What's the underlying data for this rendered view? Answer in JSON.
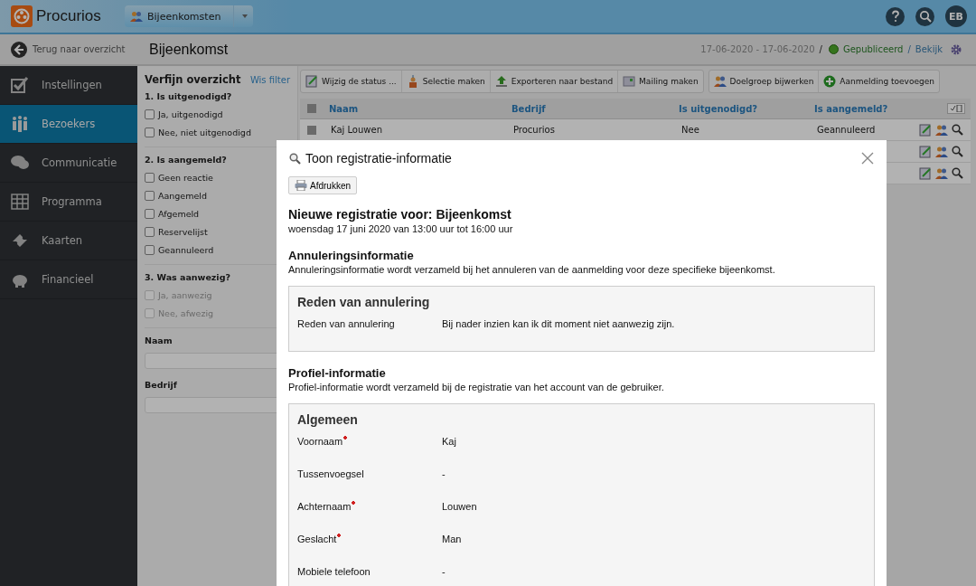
{
  "topbar": {
    "logo": "Procurios",
    "module": "Bijeenkomsten",
    "avatar": "EB"
  },
  "subheader": {
    "back": "Terug naar overzicht",
    "title": "Bijeenkomst",
    "dates": "17-06-2020 - 17-06-2020",
    "separator": "/",
    "status": "Gepubliceerd",
    "separator2": "/",
    "view": "Bekijk"
  },
  "sidebar": {
    "items": [
      {
        "label": "Instellingen",
        "kind": "check",
        "selected": false
      },
      {
        "label": "Bezoekers",
        "kind": "people",
        "selected": true
      },
      {
        "label": "Communicatie",
        "kind": "chat",
        "selected": false
      },
      {
        "label": "Programma",
        "kind": "grid",
        "selected": false
      },
      {
        "label": "Kaarten",
        "kind": "ticket",
        "selected": false
      },
      {
        "label": "Financieel",
        "kind": "piggy",
        "selected": false
      }
    ]
  },
  "filter": {
    "title": "Verfijn overzicht",
    "clear": "Wis filter",
    "groups": [
      {
        "title": "1. Is uitgenodigd?",
        "options": [
          {
            "label": "Ja, uitgenodigd",
            "checked": false,
            "disabled": false
          },
          {
            "label": "Nee, niet uitgenodigd",
            "checked": false,
            "disabled": false
          }
        ]
      },
      {
        "title": "2. Is aangemeld?",
        "options": [
          {
            "label": "Geen reactie",
            "checked": false,
            "disabled": false
          },
          {
            "label": "Aangemeld",
            "checked": false,
            "disabled": false
          },
          {
            "label": "Afgemeld",
            "checked": false,
            "disabled": false
          },
          {
            "label": "Reservelijst",
            "checked": false,
            "disabled": false
          },
          {
            "label": "Geannuleerd",
            "checked": false,
            "disabled": false
          }
        ]
      },
      {
        "title": "3. Was aanwezig?",
        "options": [
          {
            "label": "Ja, aanwezig",
            "checked": false,
            "disabled": true
          },
          {
            "label": "Nee, afwezig",
            "checked": false,
            "disabled": true
          }
        ]
      }
    ],
    "fields": [
      {
        "label": "Naam"
      },
      {
        "label": "Bedrijf"
      }
    ]
  },
  "toolbar": {
    "groups": [
      [
        {
          "label": "Wijzig de status ...",
          "kind": "edit"
        },
        {
          "label": "Selectie maken",
          "kind": "person"
        },
        {
          "label": "Exporteren naar bestand",
          "kind": "export"
        },
        {
          "label": "Mailing maken",
          "kind": "mail"
        }
      ],
      [
        {
          "label": "Doelgroep bijwerken",
          "kind": "people"
        },
        {
          "label": "Aanmelding toevoegen",
          "kind": "add"
        }
      ]
    ]
  },
  "table": {
    "select_all": {
      "checked": false
    },
    "columns": [
      "Naam",
      "Bedrijf",
      "Is uitgenodigd?",
      "Is aangemeld?"
    ],
    "rows": [
      {
        "kind": "data",
        "checked": false,
        "cells": [
          "Kaj Louwen",
          "Procurios",
          "Nee",
          "Geannuleerd"
        ]
      },
      {
        "kind": "covered"
      },
      {
        "kind": "covered"
      }
    ]
  },
  "modal": {
    "title": "Toon registratie-informatie",
    "print": "Afdrukken",
    "heading": "Nieuwe registratie voor: Bijeenkomst",
    "when": "woensdag 17 juni 2020 van 13:00 uur tot 16:00 uur",
    "sections": [
      {
        "title": "Annuleringsinformatie",
        "description": "Annuleringsinformatie wordt verzameld bij het annuleren van de aanmelding voor deze specifieke bijeenkomst.",
        "box": {
          "title": "Reden van annulering",
          "fields": [
            {
              "label": "Reden van annulering",
              "required": false,
              "value": "Bij nader inzien kan ik dit moment niet aanwezig zijn."
            }
          ]
        }
      },
      {
        "title": "Profiel-informatie",
        "description": "Profiel-informatie wordt verzameld bij de registratie van het account van de gebruiker.",
        "box": {
          "title": "Algemeen",
          "fields": [
            {
              "label": "Voornaam",
              "required": true,
              "value": "Kaj"
            },
            {
              "label": "Tussenvoegsel",
              "required": false,
              "value": "-"
            },
            {
              "label": "Achternaam",
              "required": true,
              "value": "Louwen"
            },
            {
              "label": "Geslacht",
              "required": true,
              "value": "Man"
            },
            {
              "label": "Mobiele telefoon",
              "required": false,
              "value": "-"
            }
          ]
        }
      }
    ]
  }
}
